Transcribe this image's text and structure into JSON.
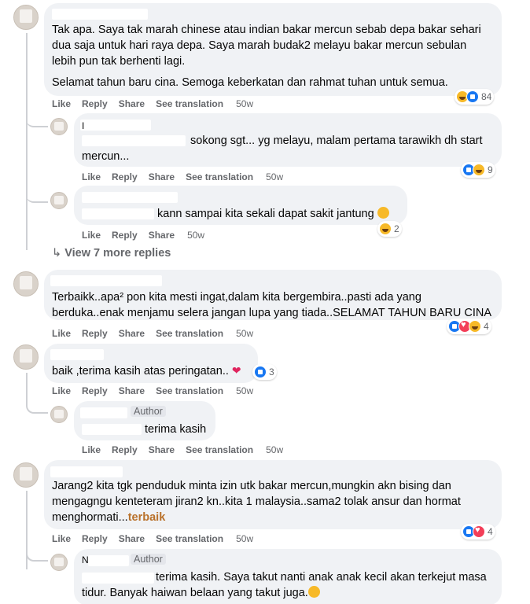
{
  "actions": {
    "like": "Like",
    "reply": "Reply",
    "share": "Share",
    "translate": "See translation"
  },
  "author_badge": "Author",
  "comments": [
    {
      "lines": [
        "Tak apa. Saya tak marah chinese atau indian bakar mercun sebab depa bakar sehari",
        "dua saja untuk hari raya depa. Saya marah budak2 melayu bakar mercun sebulan",
        "lebih pun tak berhenti lagi."
      ],
      "line_extra": "Selamat tahun baru cina. Semoga keberkatan dan rahmat tuhan untuk semua.",
      "time": "50w",
      "reaction_count": "84"
    },
    {
      "line1": "I",
      "line2": "sokong sgt... yg melayu, malam pertama tarawikh dh start",
      "line3": "mercun...",
      "time": "50w",
      "reaction_count": "9"
    },
    {
      "line1": "kann sampai kita sekali dapat sakit jantung",
      "time": "50w",
      "reaction_count": "2"
    },
    {
      "lines": [
        "Terbaikk..apa² pon kita mesti ingat,dalam kita bergembira..pasti ada yang",
        "berduka..enak menjamu selera jangan lupa yang tiada..SELAMAT TAHUN BARU CINA"
      ],
      "time": "50w",
      "reaction_count": "4"
    },
    {
      "line1": "baik ,terima kasih atas peringatan..",
      "time": "50w",
      "reaction_count": "3"
    },
    {
      "line1": "terima kasih",
      "time": "50w"
    },
    {
      "lines": [
        "Jarang2 kita tgk penduduk minta izin utk bakar mercun,mungkin akn bising dan",
        "mengagngu kenteteram jiran2 kn..kita 1 malaysia..sama2 tolak ansur dan hormat"
      ],
      "line3": "menghormati...",
      "highlight": "terbaik",
      "time": "50w",
      "reaction_count": "4"
    },
    {
      "name_partial": "N",
      "line1": "terima kasih. Saya takut nanti anak anak kecil akan terkejut masa",
      "line2": "tidur. Banyak haiwan belaan yang takut juga."
    }
  ],
  "view_more": "View 7 more replies"
}
